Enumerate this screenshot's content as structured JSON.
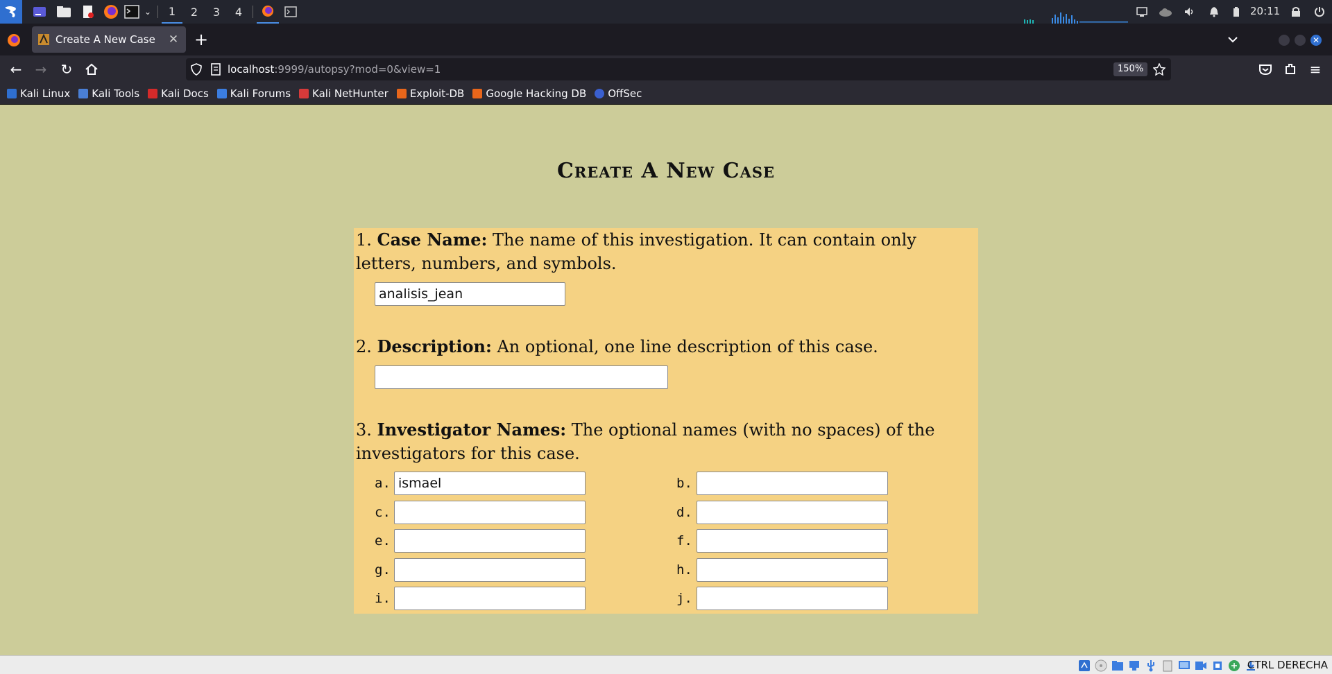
{
  "taskbar": {
    "workspaces": [
      "1",
      "2",
      "3",
      "4"
    ],
    "active_workspace": "1",
    "clock": "20:11"
  },
  "browser": {
    "tab_title": "Create A New Case",
    "url_host": "localhost",
    "url_rest": ":9999/autopsy?mod=0&view=1",
    "zoom": "150%",
    "bookmarks": [
      "Kali Linux",
      "Kali Tools",
      "Kali Docs",
      "Kali Forums",
      "Kali NetHunter",
      "Exploit-DB",
      "Google Hacking DB",
      "OffSec"
    ]
  },
  "page": {
    "title": "Create A New Case",
    "q1": {
      "num": "1.",
      "label": "Case Name:",
      "text": " The name of this investigation. It can contain only letters, numbers, and symbols.",
      "value": "analisis_jean"
    },
    "q2": {
      "num": "2.",
      "label": "Description:",
      "text": " An optional, one line description of this case.",
      "value": ""
    },
    "q3": {
      "num": "3.",
      "label": "Investigator Names:",
      "text": " The optional names (with no spaces) of the investigators for this case.",
      "investigators": [
        {
          "label": "a.",
          "value": "ismael"
        },
        {
          "label": "b.",
          "value": ""
        },
        {
          "label": "c.",
          "value": ""
        },
        {
          "label": "d.",
          "value": ""
        },
        {
          "label": "e.",
          "value": ""
        },
        {
          "label": "f.",
          "value": ""
        },
        {
          "label": "g.",
          "value": ""
        },
        {
          "label": "h.",
          "value": ""
        },
        {
          "label": "i.",
          "value": ""
        },
        {
          "label": "j.",
          "value": ""
        }
      ]
    }
  },
  "statusbar": {
    "host_key": "CTRL DERECHA"
  }
}
